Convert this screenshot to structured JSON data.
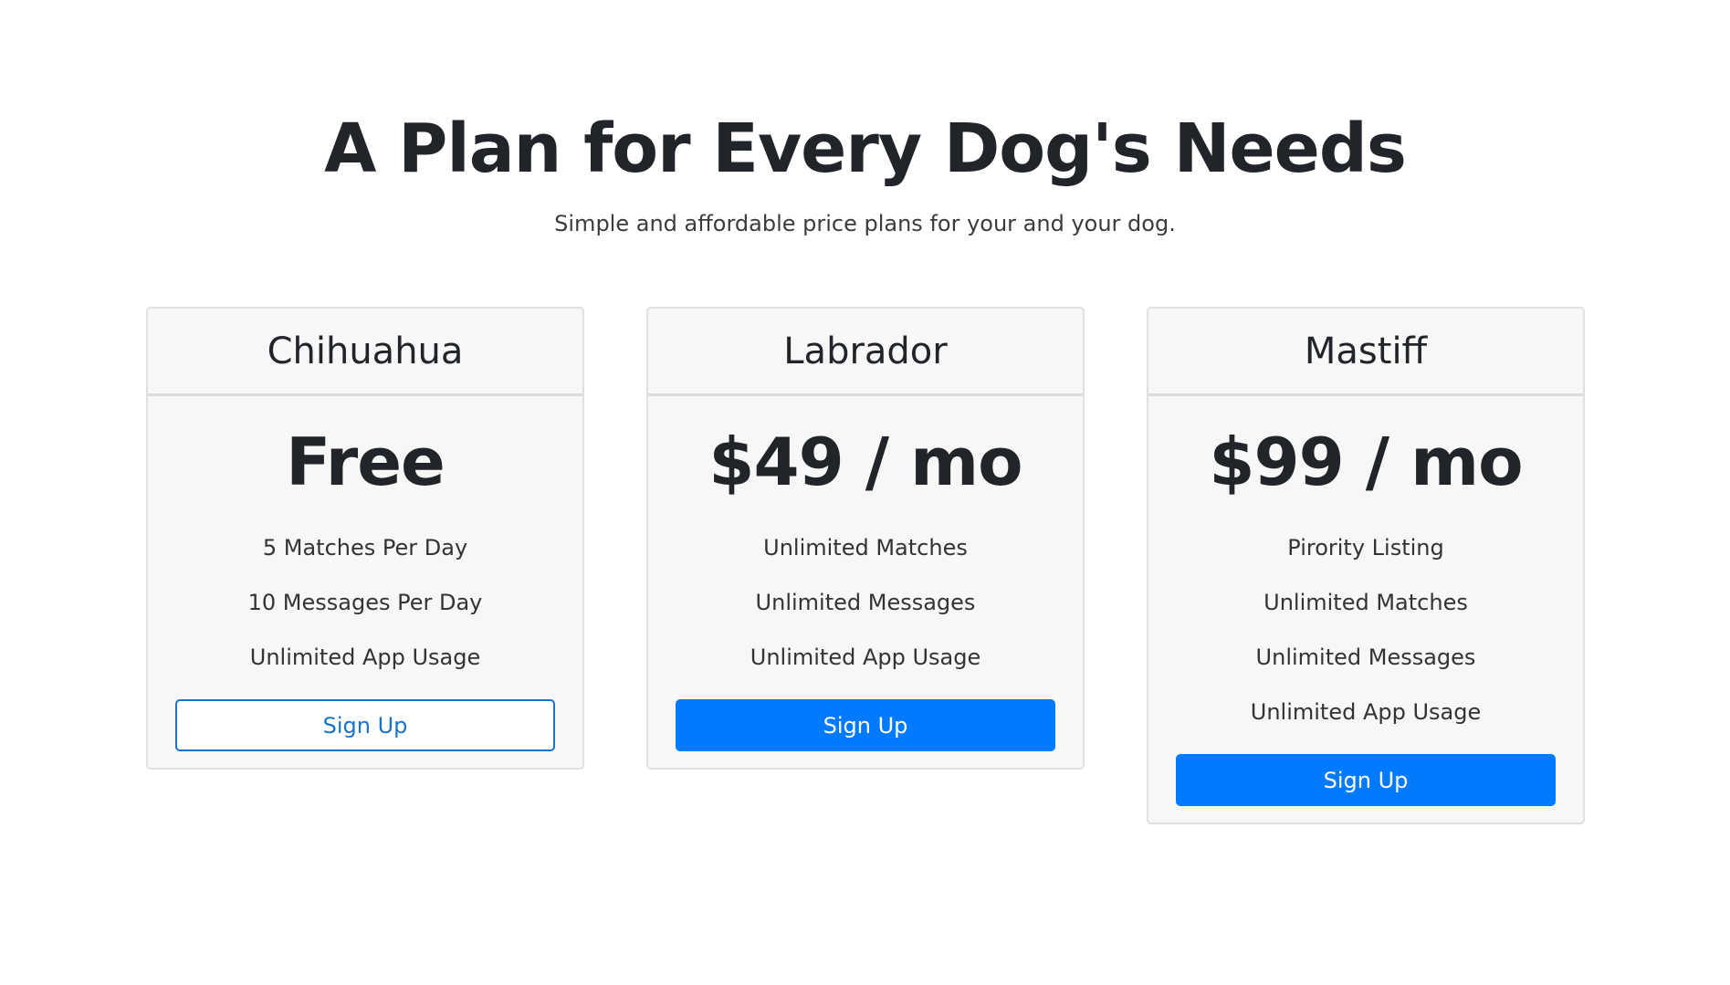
{
  "header": {
    "title": "A Plan for Every Dog's Needs",
    "subtitle": "Simple and affordable price plans for your and your dog."
  },
  "colors": {
    "primary": "#007bff",
    "outline": "#1a73c9",
    "card_bg": "#f7f7f7",
    "text": "#212529"
  },
  "plans": [
    {
      "name": "Chihuahua",
      "price": "Free",
      "features": [
        "5 Matches Per Day",
        "10 Messages Per Day",
        "Unlimited App Usage"
      ],
      "button_label": "Sign Up",
      "button_style": "outline"
    },
    {
      "name": "Labrador",
      "price": "$49 / mo",
      "features": [
        "Unlimited Matches",
        "Unlimited Messages",
        "Unlimited App Usage"
      ],
      "button_label": "Sign Up",
      "button_style": "solid"
    },
    {
      "name": "Mastiff",
      "price": "$99 / mo",
      "features": [
        "Pirority Listing",
        "Unlimited Matches",
        "Unlimited Messages",
        "Unlimited App Usage"
      ],
      "button_label": "Sign Up",
      "button_style": "solid"
    }
  ]
}
